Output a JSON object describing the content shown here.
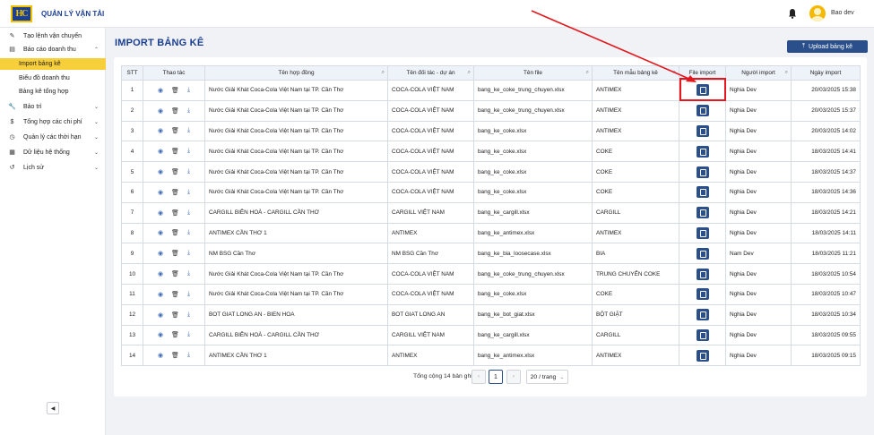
{
  "header": {
    "logo_text": "HC",
    "app_title": "QUẢN LÝ VẬN TẢI",
    "user_name": "Bao dev"
  },
  "sidebar": {
    "items": [
      {
        "label": "Tạo lệnh vận chuyển",
        "icon": "edit-icon"
      },
      {
        "label": "Báo cáo doanh thu",
        "icon": "chart-icon",
        "expanded": true
      },
      {
        "label": "Import bảng kê",
        "sub": true,
        "active": true
      },
      {
        "label": "Biểu đồ doanh thu",
        "sub": true
      },
      {
        "label": "Bảng kê tổng hợp",
        "sub": true
      },
      {
        "label": "Bảo trì",
        "icon": "wrench-icon"
      },
      {
        "label": "Tổng hợp các chi phí",
        "icon": "dollar-icon"
      },
      {
        "label": "Quản lý các thời hạn",
        "icon": "clock-icon"
      },
      {
        "label": "Dữ liệu hệ thống",
        "icon": "database-icon"
      },
      {
        "label": "Lịch sử",
        "icon": "history-icon"
      }
    ]
  },
  "page": {
    "title": "IMPORT BẢNG KÊ",
    "upload_label": "Upload bảng kê"
  },
  "table": {
    "headers": [
      "STT",
      "Thao tác",
      "Tên hợp đồng",
      "Tên đối tác - dự án",
      "Tên file",
      "Tên mẫu bảng kê",
      "File import",
      "Người import",
      "Ngày import"
    ],
    "rows": [
      {
        "stt": "1",
        "contract": "Nước Giải Khát Coca-Cola Việt Nam tại TP. Cần Thơ",
        "partner": "COCA-COLA VIỆT NAM",
        "file": "bang_ke_coke_trung_chuyen.xlsx",
        "template": "ANTIMEX",
        "user": "Nghia Dev",
        "date": "20/03/2025 15:38"
      },
      {
        "stt": "2",
        "contract": "Nước Giải Khát Coca-Cola Việt Nam tại TP. Cần Thơ",
        "partner": "COCA-COLA VIỆT NAM",
        "file": "bang_ke_coke_trung_chuyen.xlsx",
        "template": "ANTIMEX",
        "user": "Nghia Dev",
        "date": "20/03/2025 15:37"
      },
      {
        "stt": "3",
        "contract": "Nước Giải Khát Coca-Cola Việt Nam tại TP. Cần Thơ",
        "partner": "COCA-COLA VIỆT NAM",
        "file": "bang_ke_coke.xlsx",
        "template": "ANTIMEX",
        "user": "Nghia Dev",
        "date": "20/03/2025 14:02"
      },
      {
        "stt": "4",
        "contract": "Nước Giải Khát Coca-Cola Việt Nam tại TP. Cần Thơ",
        "partner": "COCA-COLA VIỆT NAM",
        "file": "bang_ke_coke.xlsx",
        "template": "COKE",
        "user": "Nghia Dev",
        "date": "18/03/2025 14:41"
      },
      {
        "stt": "5",
        "contract": "Nước Giải Khát Coca-Cola Việt Nam tại TP. Cần Thơ",
        "partner": "COCA-COLA VIỆT NAM",
        "file": "bang_ke_coke.xlsx",
        "template": "COKE",
        "user": "Nghia Dev",
        "date": "18/03/2025 14:37"
      },
      {
        "stt": "6",
        "contract": "Nước Giải Khát Coca-Cola Việt Nam tại TP. Cần Thơ",
        "partner": "COCA-COLA VIỆT NAM",
        "file": "bang_ke_coke.xlsx",
        "template": "COKE",
        "user": "Nghia Dev",
        "date": "18/03/2025 14:36"
      },
      {
        "stt": "7",
        "contract": "CARGILL BIÊN HOÀ - CARGILL CẦN THƠ",
        "partner": "CARGILL VIỆT NAM",
        "file": "bang_ke_cargill.xlsx",
        "template": "CARGILL",
        "user": "Nghia Dev",
        "date": "18/03/2025 14:21"
      },
      {
        "stt": "8",
        "contract": "ANTIMEX CẦN THƠ 1",
        "partner": "ANTIMEX",
        "file": "bang_ke_antimex.xlsx",
        "template": "ANTIMEX",
        "user": "Nghia Dev",
        "date": "18/03/2025 14:11"
      },
      {
        "stt": "9",
        "contract": "NM BSG Cần Thơ",
        "partner": "NM BSG Cần Thơ",
        "file": "bang_ke_bia_loosecase.xlsx",
        "template": "BIA",
        "user": "Nam Dev",
        "date": "18/03/2025 11:21"
      },
      {
        "stt": "10",
        "contract": "Nước Giải Khát Coca-Cola Việt Nam tại TP. Cần Thơ",
        "partner": "COCA-COLA VIỆT NAM",
        "file": "bang_ke_coke_trung_chuyen.xlsx",
        "template": "TRUNG CHUYỂN COKE",
        "user": "Nghia Dev",
        "date": "18/03/2025 10:54"
      },
      {
        "stt": "11",
        "contract": "Nước Giải Khát Coca-Cola Việt Nam tại TP. Cần Thơ",
        "partner": "COCA-COLA VIỆT NAM",
        "file": "bang_ke_coke.xlsx",
        "template": "COKE",
        "user": "Nghia Dev",
        "date": "18/03/2025 10:47"
      },
      {
        "stt": "12",
        "contract": "BOT GIAT LONG AN - BIEN HOA",
        "partner": "BOT GIAT LONG AN",
        "file": "bang_ke_bot_giat.xlsx",
        "template": "BỘT GIẶT",
        "user": "Nghia Dev",
        "date": "18/03/2025 10:34"
      },
      {
        "stt": "13",
        "contract": "CARGILL BIÊN HOÀ - CARGILL CẦN THƠ",
        "partner": "CARGILL VIỆT NAM",
        "file": "bang_ke_cargill.xlsx",
        "template": "CARGILL",
        "user": "Nghia Dev",
        "date": "18/03/2025 09:55"
      },
      {
        "stt": "14",
        "contract": "ANTIMEX CẦN THƠ 1",
        "partner": "ANTIMEX",
        "file": "bang_ke_antimex.xlsx",
        "template": "ANTIMEX",
        "user": "Nghia Dev",
        "date": "18/03/2025 09:15"
      }
    ]
  },
  "pagination": {
    "total_text": "Tổng cộng 14 bản ghi",
    "current_page": "1",
    "page_size": "20 / trang"
  },
  "colors": {
    "primary": "#2a4f8a",
    "active_bg": "#f7cf3a",
    "annotation": "#e3171d"
  }
}
